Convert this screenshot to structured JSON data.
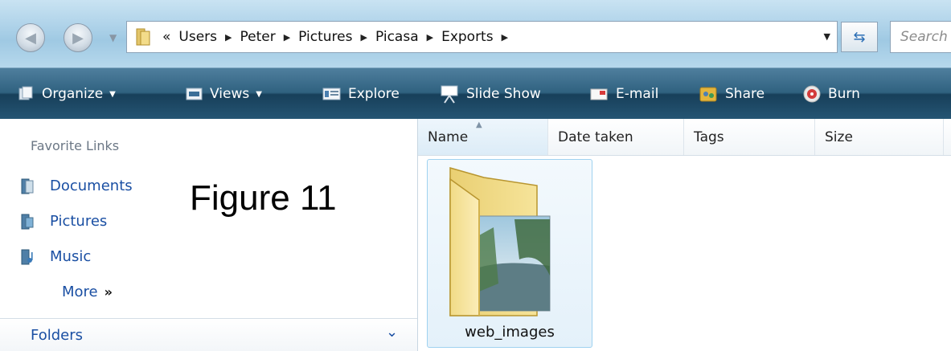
{
  "address_bar": {
    "overflow_glyph": "«",
    "breadcrumbs": [
      "Users",
      "Peter",
      "Pictures",
      "Picasa",
      "Exports"
    ],
    "search_placeholder": "Search"
  },
  "toolbar": {
    "items": [
      {
        "label": "Organize",
        "icon": "organize-icon",
        "dropdown": true
      },
      {
        "label": "Views",
        "icon": "views-icon",
        "dropdown": true
      },
      {
        "label": "Explore",
        "icon": "explore-icon",
        "dropdown": false
      },
      {
        "label": "Slide Show",
        "icon": "slideshow-icon",
        "dropdown": false
      },
      {
        "label": "E-mail",
        "icon": "email-icon",
        "dropdown": false
      },
      {
        "label": "Share",
        "icon": "share-icon",
        "dropdown": false
      },
      {
        "label": "Burn",
        "icon": "burn-icon",
        "dropdown": false
      }
    ]
  },
  "sidebar": {
    "favorites_title": "Favorite Links",
    "items": [
      {
        "label": "Documents",
        "icon": "documents-icon"
      },
      {
        "label": "Pictures",
        "icon": "pictures-icon"
      },
      {
        "label": "Music",
        "icon": "music-icon"
      }
    ],
    "more_label": "More",
    "more_glyph": "»",
    "folders_label": "Folders"
  },
  "overlay": {
    "figure_label": "Figure 11"
  },
  "file_list": {
    "columns": [
      "Name",
      "Date taken",
      "Tags",
      "Size"
    ],
    "sorted_column": "Name",
    "items": [
      {
        "name": "web_images",
        "type": "folder"
      }
    ]
  },
  "colors": {
    "toolbar_bg": "#255573",
    "link_blue": "#1a4fa3",
    "selection_border": "#9fd2f0"
  }
}
